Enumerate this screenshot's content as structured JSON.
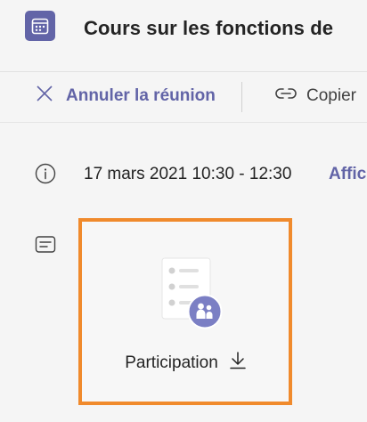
{
  "header": {
    "title": "Cours sur les fonctions de",
    "icon": "calendar-icon",
    "accent_color": "#6264a7"
  },
  "toolbar": {
    "cancel_label": "Annuler la réunion",
    "copy_label": "Copier"
  },
  "details": {
    "datetime": "17 mars 2021 10:30 - 12:30",
    "show_link": "Affic"
  },
  "attachment": {
    "label": "Participation",
    "highlight_color": "#f08a2c"
  }
}
